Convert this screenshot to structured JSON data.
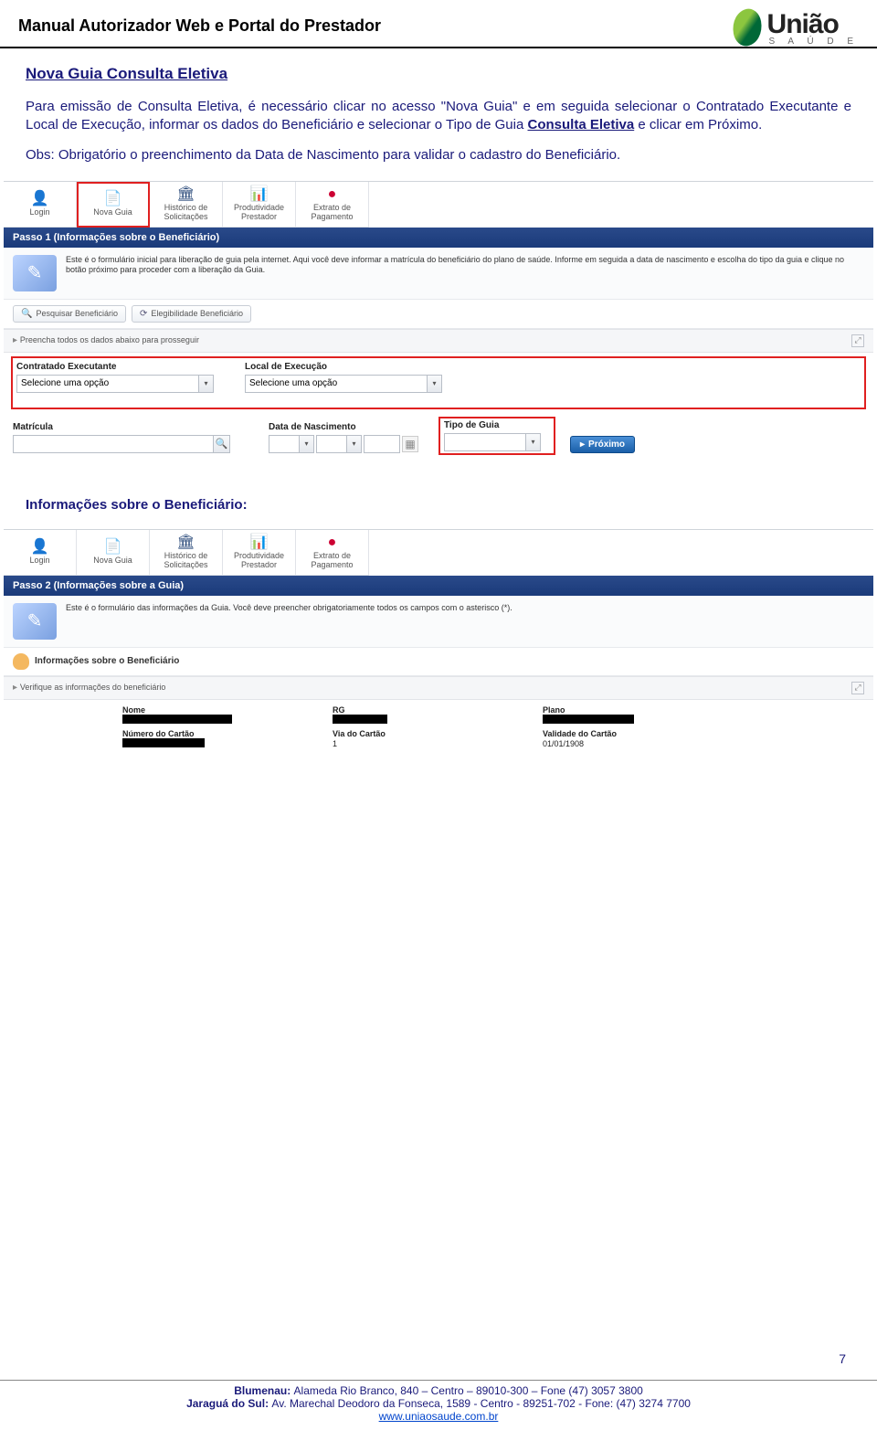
{
  "header": {
    "title": "Manual Autorizador Web e Portal do Prestador",
    "logo_main": "União",
    "logo_sub": "S A Ú D E"
  },
  "section1": {
    "heading": "Nova Guia Consulta Eletiva",
    "p1a": "Para emissão de Consulta Eletiva, é necessário clicar no acesso \"Nova Guia\" e em seguida selecionar o Contratado Executante e Local de Execução, informar os dados do Beneficiário e selecionar o Tipo de Guia ",
    "p1b": "Consulta Eletiva",
    "p1c": " e clicar em Próximo.",
    "p2": "Obs: Obrigatório o preenchimento da Data de Nascimento para validar o cadastro do Beneficiário."
  },
  "shot1": {
    "toolbar": [
      {
        "label": "Login",
        "glyph": "👤"
      },
      {
        "label": "Nova Guia",
        "glyph": "📄"
      },
      {
        "label": "Histórico de\nSolicitações",
        "glyph": "🏛"
      },
      {
        "label": "Produtividade\nPrestador",
        "glyph": "📊"
      },
      {
        "label": "Extrato de\nPagamento",
        "glyph": "●"
      }
    ],
    "step": "Passo 1 (Informações sobre o Beneficiário)",
    "info": "Este é o formulário inicial para liberação de guia pela internet. Aqui você deve informar a matrícula do beneficiário do plano de saúde. Informe em seguida a data de nascimento e escolha do tipo da guia e clique no botão próximo para proceder com a liberação da Guia.",
    "btn_pesq": "Pesquisar Beneficiário",
    "btn_eleg": "Elegibilidade Beneficiário",
    "bar1": "Preencha todos os dados abaixo para prosseguir",
    "lbl_contratado": "Contratado Executante",
    "lbl_local": "Local de Execução",
    "opt_placeholder": "Selecione uma opção",
    "lbl_matricula": "Matrícula",
    "lbl_data": "Data de Nascimento",
    "lbl_tipo": "Tipo de Guia",
    "btn_proximo": "Próximo"
  },
  "section2": {
    "heading": "Informações sobre o Beneficiário:"
  },
  "shot2": {
    "step": "Passo 2 (Informações sobre a Guia)",
    "info": "Este é o formulário das informações da Guia. Você deve preencher obrigatoriamente todos os campos com o asterisco (*).",
    "benef_header": "Informações sobre o Beneficiário",
    "bar": "Verifique as informações do beneficiário",
    "lbl_nome": "Nome",
    "lbl_rg": "RG",
    "lbl_plano": "Plano",
    "lbl_numcartao": "Número do Cartão",
    "lbl_viacartao": "Via do Cartão",
    "val_viacartao": "1",
    "lbl_validade": "Validade do Cartão",
    "val_validade": "01/01/1908"
  },
  "footer": {
    "line1a": "Blumenau: ",
    "line1b": "Alameda Rio Branco, 840 – Centro – 89010-300 – Fone (47) 3057 3800",
    "line2a": "Jaraguá do Sul: ",
    "line2b": "Av. Marechal Deodoro da Fonseca, 1589 - Centro - 89251-702 - Fone: (47) 3274 7700",
    "link": "www.uniaosaude.com.br"
  },
  "page": "7"
}
